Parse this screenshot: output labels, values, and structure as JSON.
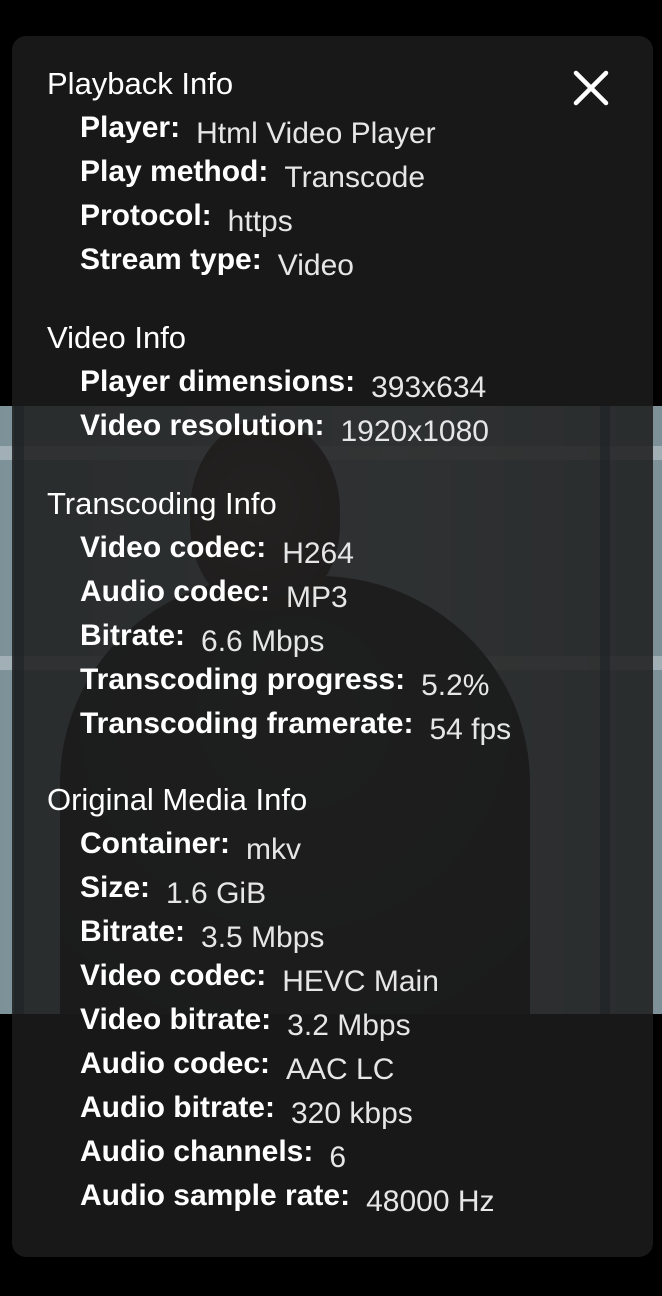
{
  "close_icon": "close-icon",
  "sections": [
    {
      "title": "Playback Info",
      "rows": [
        {
          "label": "Player",
          "value": "Html Video Player"
        },
        {
          "label": "Play method",
          "value": "Transcode"
        },
        {
          "label": "Protocol",
          "value": "https"
        },
        {
          "label": "Stream type",
          "value": "Video"
        }
      ]
    },
    {
      "title": "Video Info",
      "rows": [
        {
          "label": "Player dimensions",
          "value": "393x634"
        },
        {
          "label": "Video resolution",
          "value": "1920x1080"
        }
      ]
    },
    {
      "title": "Transcoding Info",
      "rows": [
        {
          "label": "Video codec",
          "value": "H264"
        },
        {
          "label": "Audio codec",
          "value": "MP3"
        },
        {
          "label": "Bitrate",
          "value": "6.6 Mbps"
        },
        {
          "label": "Transcoding progress",
          "value": "5.2%"
        },
        {
          "label": "Transcoding framerate",
          "value": "54 fps"
        }
      ]
    },
    {
      "title": "Original Media Info",
      "rows": [
        {
          "label": "Container",
          "value": "mkv"
        },
        {
          "label": "Size",
          "value": "1.6 GiB"
        },
        {
          "label": "Bitrate",
          "value": "3.5 Mbps"
        },
        {
          "label": "Video codec",
          "value": "HEVC Main"
        },
        {
          "label": "Video bitrate",
          "value": "3.2 Mbps"
        },
        {
          "label": "Audio codec",
          "value": "AAC LC"
        },
        {
          "label": "Audio bitrate",
          "value": "320 kbps"
        },
        {
          "label": "Audio channels",
          "value": "6"
        },
        {
          "label": "Audio sample rate",
          "value": "48000 Hz"
        }
      ]
    }
  ]
}
